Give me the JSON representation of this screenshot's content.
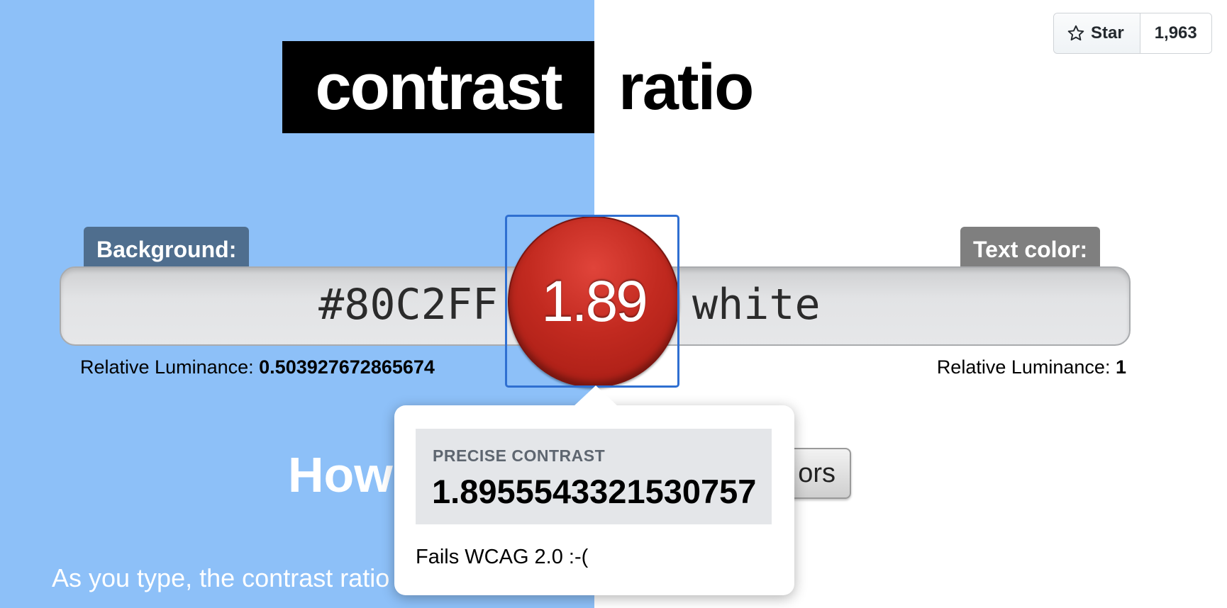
{
  "colors": {
    "background_color": "#80C2FF",
    "text_color": "#ffffff",
    "fail_red": "#c22a20"
  },
  "title": {
    "word1": "contrast",
    "word2": "ratio"
  },
  "github": {
    "star_label": "Star",
    "star_count": "1,963",
    "icon": "star-icon"
  },
  "background": {
    "label": "Background:",
    "value": "#80C2FF",
    "luminance_label": "Relative Luminance:",
    "luminance_value": "0.503927672865674"
  },
  "foreground": {
    "label": "Text color:",
    "value": "white",
    "luminance_label": "Relative Luminance:",
    "luminance_value": "1"
  },
  "ratio": {
    "display": "1.89"
  },
  "tooltip": {
    "precise_label": "PRECISE CONTRAST",
    "precise_value": "1.8955543321530757",
    "status": "Fails WCAG 2.0 :-("
  },
  "partial": {
    "heading": "How",
    "swap_button_label": "ors",
    "intro_text": "As you type, the contrast ratio"
  }
}
